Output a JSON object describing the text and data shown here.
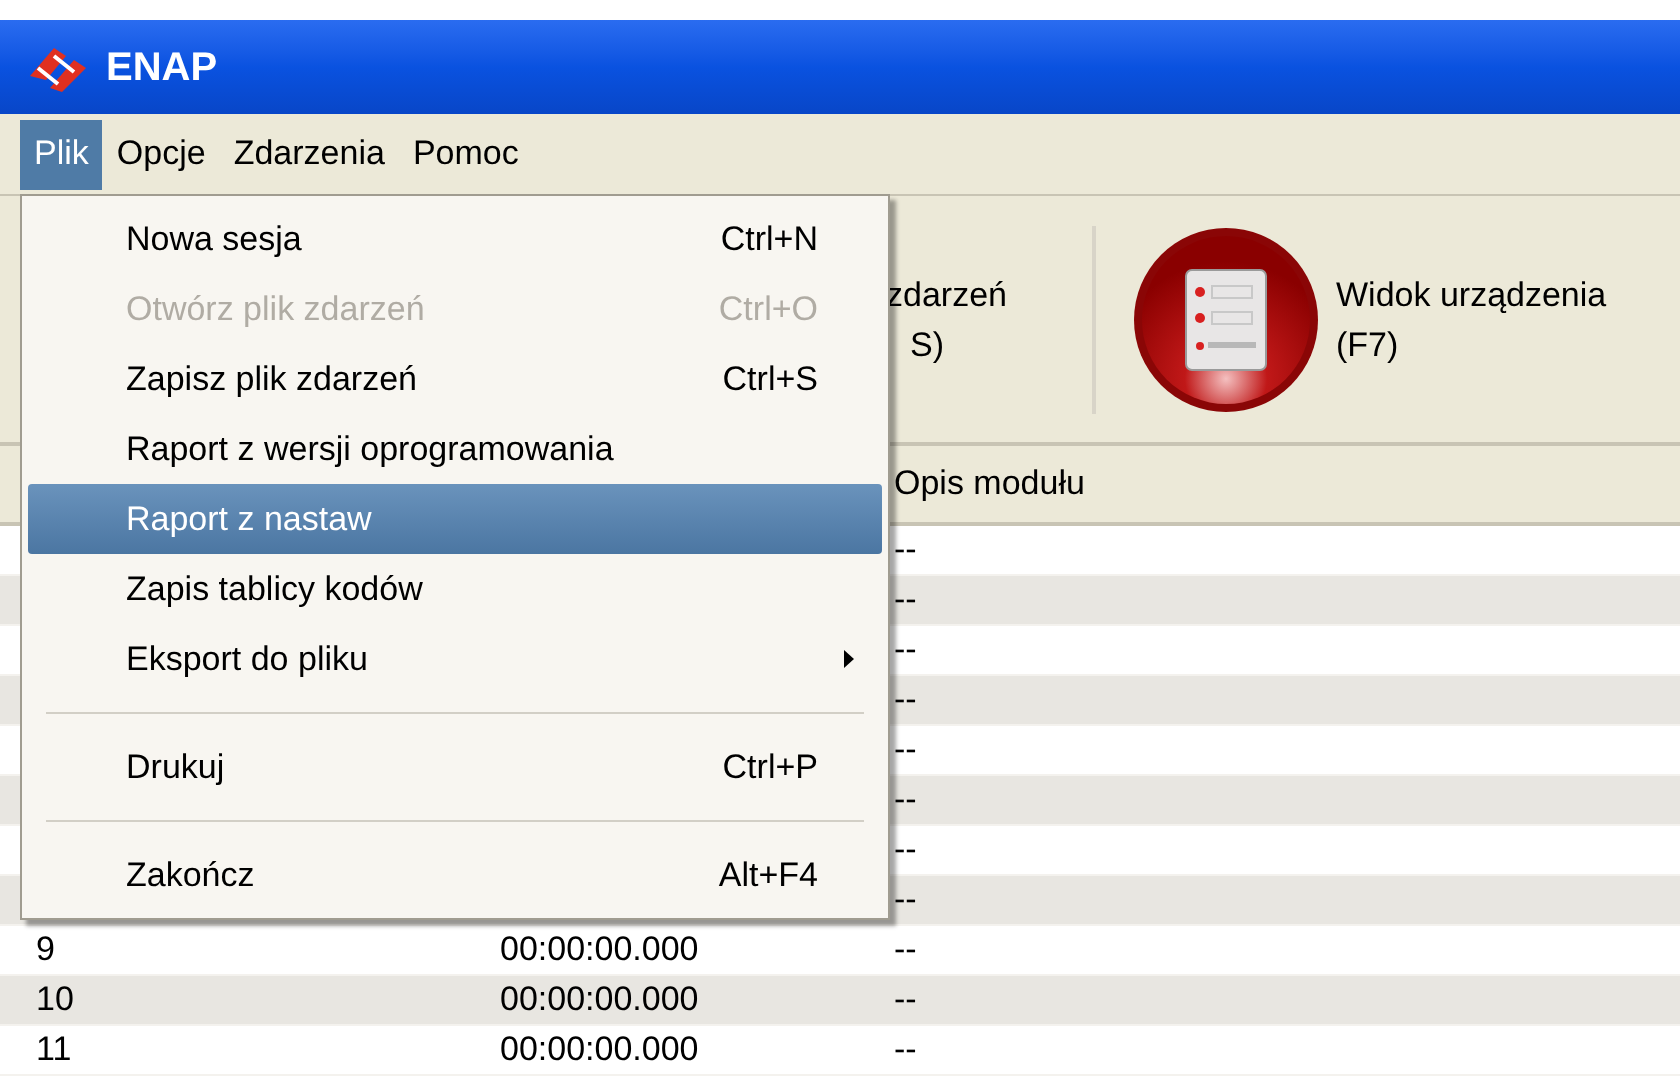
{
  "window": {
    "title": "ENAP"
  },
  "menu_bar": [
    {
      "label": "Plik",
      "selected": true
    },
    {
      "label": "Opcje",
      "selected": false
    },
    {
      "label": "Zdarzenia",
      "selected": false
    },
    {
      "label": "Pomoc",
      "selected": false
    }
  ],
  "menu": [
    {
      "kind": "item",
      "label": "Nowa sesja",
      "shortcut": "Ctrl+N",
      "disabled": false,
      "selected": false
    },
    {
      "kind": "item",
      "label": "Otwórz plik zdarzeń",
      "shortcut": "Ctrl+O",
      "disabled": true,
      "selected": false
    },
    {
      "kind": "item",
      "label": "Zapisz plik zdarzeń",
      "shortcut": "Ctrl+S",
      "disabled": false,
      "selected": false
    },
    {
      "kind": "item",
      "label": "Raport z wersji oprogramowania",
      "disabled": false,
      "selected": false
    },
    {
      "kind": "item",
      "label": "Raport z nastaw",
      "disabled": false,
      "selected": true
    },
    {
      "kind": "item",
      "label": "Zapis tablicy kodów",
      "disabled": false,
      "selected": false
    },
    {
      "kind": "submenu",
      "label": "Eksport do pliku",
      "disabled": false,
      "selected": false
    },
    {
      "kind": "separator"
    },
    {
      "kind": "item",
      "label": "Drukuj",
      "shortcut": "Ctrl+P",
      "disabled": false,
      "selected": false
    },
    {
      "kind": "separator"
    },
    {
      "kind": "item",
      "label": "Zakończ",
      "shortcut": "Alt+F4",
      "disabled": false,
      "selected": false
    }
  ],
  "toolbar": [
    {
      "kind": "partial",
      "lines": [
        "zdarzeń",
        "S)"
      ]
    },
    {
      "kind": "device",
      "lines": [
        "Widok urządzenia",
        "(F7)"
      ]
    }
  ],
  "table": {
    "columns": [
      {
        "label": "Opis modułu"
      }
    ],
    "rows": [
      {
        "column_3": "--"
      },
      {
        "column_3": "--"
      },
      {
        "column_3": "--"
      },
      {
        "column_3": "--"
      },
      {
        "column_3": "--"
      },
      {
        "column_3": "--"
      },
      {
        "column_3": "--"
      },
      {
        "column_3": "--"
      },
      {
        "number": "9",
        "time": "00:00:00.000",
        "column_3": "--"
      },
      {
        "number": "10",
        "time": "00:00:00.000",
        "column_3": "--"
      },
      {
        "number": "11",
        "time": "00:00:00.000",
        "column_3": "--"
      }
    ]
  }
}
